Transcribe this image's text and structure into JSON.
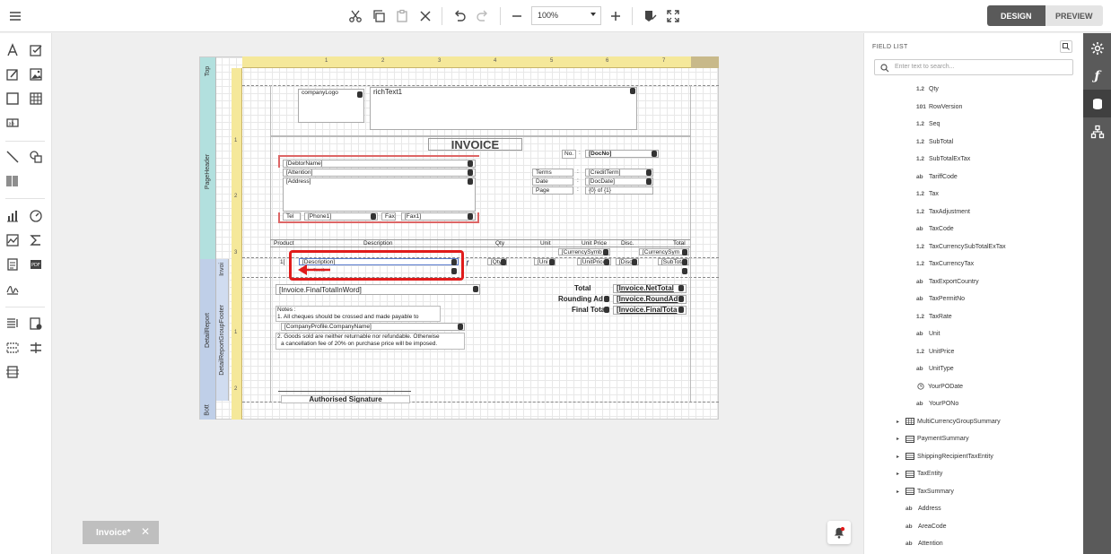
{
  "toolbar": {
    "zoom_value": "100%",
    "mode_design": "DESIGN",
    "mode_preview": "PREVIEW"
  },
  "report": {
    "bands": {
      "top": "Top",
      "page_header": "PageHeader",
      "detail_short": "Invoi",
      "detail_report": "DetailReport",
      "group_footer": "DetailReportGroupFooter",
      "bottom": "Bott"
    },
    "ruler_top": [
      "1",
      "2",
      "3",
      "4",
      "5",
      "6",
      "7"
    ],
    "ruler_left_header": [
      "1",
      "2",
      "3"
    ],
    "ruler_left_footer": [
      "1",
      "2"
    ],
    "company_logo": "companyLogo",
    "rich_text": "richText1",
    "title": "INVOICE",
    "no_label": "No.",
    "doc_no": "[DocNo]",
    "debtor": "[DebtorName]",
    "attention": "[Attention]",
    "address": "[Address]",
    "terms_label": "Terms",
    "terms_value": "[CreditTerm]",
    "date_label": "Date",
    "date_value": "[DocDate]",
    "page_label": "Page",
    "page_value": "{0} of {1}",
    "colon": ":",
    "tel_label": "Tel",
    "phone": "[Phone1]",
    "fax_label": "Fax",
    "fax": "[Fax1]",
    "columns": [
      "Product",
      "Description",
      "Qty",
      "Unit",
      "Unit Price",
      "Disc.",
      "Total"
    ],
    "currency_symbol": "[CurrencySymb",
    "currency_symbol2": "[CurrencySym",
    "row_seq": "1[",
    "row_desc": "[Description]",
    "row_qty": "[Qty",
    "row_unit": "[Uni",
    "row_unitprice": "[UnitPrice",
    "row_disc": "[Disc",
    "row_subtotal": "[SubTota",
    "row_text": "Text1",
    "total_in_word": "[Invoice.FinalTotalInWord]",
    "total_label": "Total",
    "total_value": "[Invoice.NetTotal",
    "rounding_label": "Rounding Ad",
    "rounding_value": "[Invoice.RoundAd",
    "final_label": "Final Tota",
    "final_value": "[Invoice.FinalTota",
    "notes_title": "Notes :",
    "notes_1": "1. All cheques should be crossed and made payable to",
    "company_name": "[CompanyProfile.CompanyName]",
    "notes_2a": "2. Goods sold are neither returnable nor refundable. Otherwise",
    "notes_2b": "a cancellation fee of 20% on purchase price will be imposed.",
    "signature": "Authorised Signature"
  },
  "doc_tab": {
    "label": "Invoice*",
    "close": "✕"
  },
  "field_panel": {
    "title": "FIELD LIST",
    "search_placeholder": "Enter text to search...",
    "items": [
      {
        "type": "1.2",
        "name": "Qty"
      },
      {
        "type": "101",
        "name": "RowVersion"
      },
      {
        "type": "1.2",
        "name": "Seq"
      },
      {
        "type": "1.2",
        "name": "SubTotal"
      },
      {
        "type": "1.2",
        "name": "SubTotalExTax"
      },
      {
        "type": "ab",
        "name": "TariffCode"
      },
      {
        "type": "1.2",
        "name": "Tax"
      },
      {
        "type": "1.2",
        "name": "TaxAdjustment"
      },
      {
        "type": "ab",
        "name": "TaxCode"
      },
      {
        "type": "1.2",
        "name": "TaxCurrencySubTotalExTax"
      },
      {
        "type": "1.2",
        "name": "TaxCurrencyTax"
      },
      {
        "type": "ab",
        "name": "TaxExportCountry"
      },
      {
        "type": "ab",
        "name": "TaxPermitNo"
      },
      {
        "type": "1.2",
        "name": "TaxRate"
      },
      {
        "type": "ab",
        "name": "Unit"
      },
      {
        "type": "1.2",
        "name": "UnitPrice"
      },
      {
        "type": "ab",
        "name": "UnitType"
      },
      {
        "type": "clock",
        "name": "YourPODate"
      },
      {
        "type": "ab",
        "name": "YourPONo"
      }
    ],
    "groups": [
      {
        "icon": "grid",
        "name": "MultiCurrencyGroupSummary"
      },
      {
        "icon": "list",
        "name": "PaymentSummary"
      },
      {
        "icon": "list",
        "name": "ShippingRecipientTaxEntity"
      },
      {
        "icon": "list",
        "name": "TaxEntity"
      },
      {
        "icon": "list",
        "name": "TaxSummary"
      }
    ],
    "root_items": [
      {
        "type": "ab",
        "name": "Address"
      },
      {
        "type": "ab",
        "name": "AreaCode"
      },
      {
        "type": "ab",
        "name": "Attention"
      }
    ]
  },
  "colors": {
    "annotation": "#e01b1b",
    "band_teal": "#b2e0de",
    "band_blue": "#bfcfe8",
    "ruler": "#f5e89a",
    "mode_active": "#5a5a5a",
    "rightbar": "#5a5a5a"
  }
}
